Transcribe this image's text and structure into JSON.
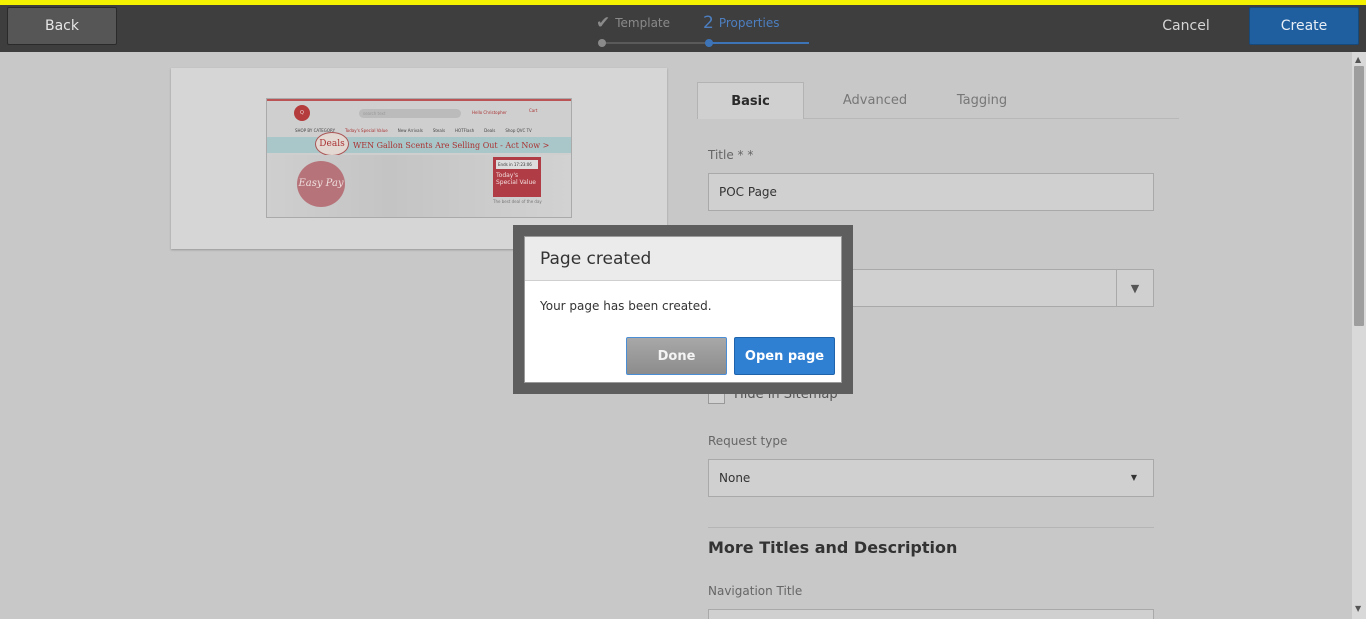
{
  "header": {
    "back_label": "Back",
    "cancel_label": "Cancel",
    "create_label": "Create",
    "steps": [
      {
        "label": "Template",
        "marker": "✔"
      },
      {
        "label": "Properties",
        "marker": "2"
      }
    ]
  },
  "preview": {
    "search_placeholder": "search text",
    "user_text": "Hello Christopher",
    "cart_text": "Cart",
    "nav_category": "SHOP BY CATEGORY",
    "nav_links": [
      "Today's Special Value",
      "New Arrivals",
      "Steals",
      "HOTFlash",
      "Deals",
      "Shop QVC TV"
    ],
    "deals_badge": "Deals",
    "headline": "WEN Gallon Scents Are Selling Out - Act Now >",
    "easy_pay": "Easy Pay",
    "tsv_ends": "Ends in 17:23:06",
    "tsv_title": "Today's Special Value",
    "tsv_tag": "The best deal of the day"
  },
  "form": {
    "tabs": [
      "Basic",
      "Advanced",
      "Tagging"
    ],
    "title_label": "Title * *",
    "title_value": "POC Page",
    "hide_sitemap_label": "Hide in Sitemap",
    "request_type_label": "Request type",
    "request_type_value": "None",
    "more_titles_heading": "More Titles and Description",
    "navigation_title_label": "Navigation Title"
  },
  "dialog": {
    "title": "Page created",
    "message": "Your page has been created.",
    "done_label": "Done",
    "open_label": "Open page"
  },
  "colors": {
    "accent": "#2f7fd3",
    "highlight_bar": "#f4f200",
    "topbar": "#3e3e3e"
  }
}
